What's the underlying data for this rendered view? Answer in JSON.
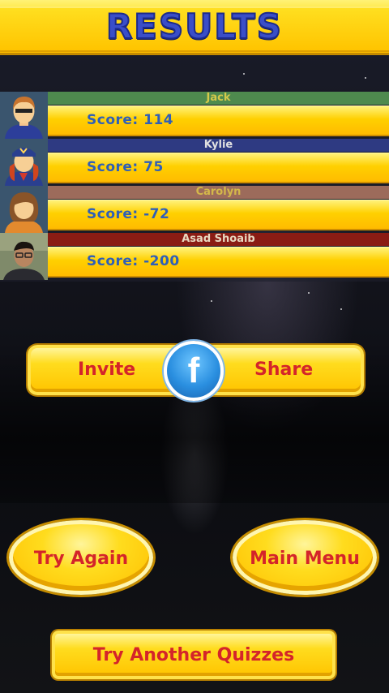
{
  "header": {
    "title": "RESULTS"
  },
  "players": [
    {
      "name": "Jack",
      "score_text": "Score: 114",
      "score": 114,
      "band_color": "#4e8a4e",
      "name_color": "#d4c84a",
      "avatar": "man-avatar-icon"
    },
    {
      "name": "Kylie",
      "score_text": "Score: 75",
      "score": 75,
      "band_color": "#2e3a82",
      "name_color": "#e0e0e0",
      "avatar": "pilot-woman-avatar-icon"
    },
    {
      "name": "Carolyn",
      "score_text": "Score: -72",
      "score": -72,
      "band_color": "#9c6b5b",
      "name_color": "#d4b84a",
      "avatar": "woman-avatar-icon"
    },
    {
      "name": "Asad Shoaib",
      "score_text": "Score: -200",
      "score": -200,
      "band_color": "#8a1c14",
      "name_color": "#e8d8c0",
      "avatar": "user-photo"
    }
  ],
  "social": {
    "invite_label": "Invite",
    "share_label": "Share",
    "facebook_glyph": "f"
  },
  "buttons": {
    "try_again": "Try Again",
    "main_menu": "Main Menu",
    "try_another": "Try Another Quizzes"
  },
  "colors": {
    "gold": "#ffd000",
    "label_red": "#d4242a",
    "score_blue": "#2f5fb8",
    "title_blue": "#3a4ec8"
  }
}
